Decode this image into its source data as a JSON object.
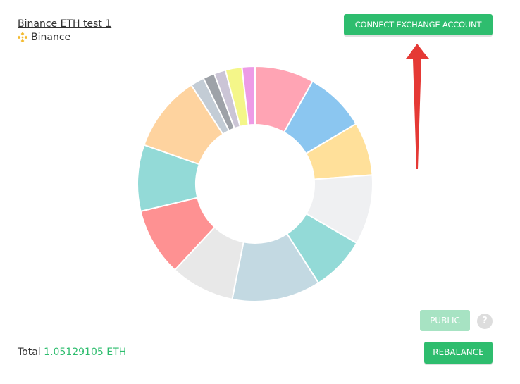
{
  "portfolio": {
    "name": "Binance ETH test 1",
    "exchange": "Binance"
  },
  "buttons": {
    "connect": "CONNECT EXCHANGE ACCOUNT",
    "public": "PUBLIC",
    "help": "?",
    "rebalance": "REBALANCE"
  },
  "total": {
    "label": "Total",
    "value": "1.05129105 ETH"
  },
  "colors": {
    "accent": "#2ebd6e",
    "accent_disabled": "#a7e3c3",
    "binance_icon": "#f3ba2f",
    "annotation_arrow": "#e53935"
  },
  "chart_data": {
    "type": "pie",
    "donut": true,
    "slices": [
      {
        "value": 8.2,
        "color": "#ffa4b4"
      },
      {
        "value": 8.4,
        "color": "#8bc6f0"
      },
      {
        "value": 7.4,
        "color": "#ffe09a"
      },
      {
        "value": 9.7,
        "color": "#eff0f2"
      },
      {
        "value": 7.6,
        "color": "#93dad7"
      },
      {
        "value": 12.3,
        "color": "#c3d9e2"
      },
      {
        "value": 8.9,
        "color": "#e8e8e8"
      },
      {
        "value": 9.4,
        "color": "#fe9192"
      },
      {
        "value": 9.2,
        "color": "#93dad7"
      },
      {
        "value": 10.6,
        "color": "#fed39f"
      },
      {
        "value": 1.9,
        "color": "#c3ccd5"
      },
      {
        "value": 1.6,
        "color": "#9ea2a8"
      },
      {
        "value": 1.6,
        "color": "#cbc5d6"
      },
      {
        "value": 2.3,
        "color": "#f4f689"
      },
      {
        "value": 1.8,
        "color": "#ed9be6"
      }
    ]
  }
}
